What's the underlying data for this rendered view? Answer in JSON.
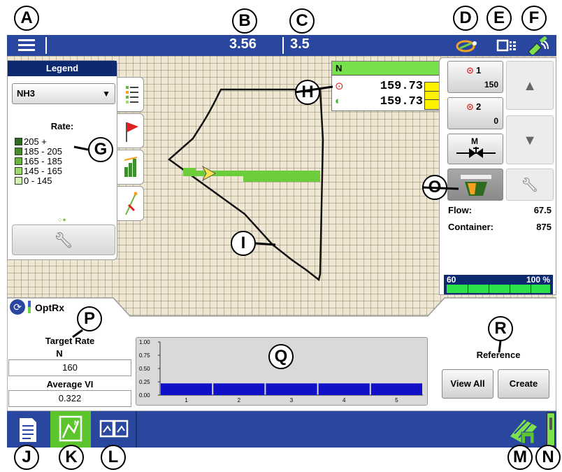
{
  "top_bar": {
    "value_b": "3.56",
    "value_c": "3.5",
    "menu_icon": "hamburger-menu-icon",
    "status_icons": [
      "guidance-icon",
      "implement-icon",
      "gps-satellite-icon"
    ]
  },
  "legend": {
    "title": "Legend",
    "product": "NH3",
    "rate_title": "Rate:",
    "ranges": [
      {
        "label": "205 +",
        "color": "#2e6b1f"
      },
      {
        "label": "185 - 205",
        "color": "#4a8a2a"
      },
      {
        "label": "165 - 185",
        "color": "#6cb33d"
      },
      {
        "label": "145 - 165",
        "color": "#9fd86a"
      },
      {
        "label": "0 - 145",
        "color": "#d4f2b2"
      }
    ],
    "tabs": [
      "legend-list-icon",
      "flag-icon",
      "bar-chart-icon",
      "guidance-line-icon"
    ]
  },
  "n_box": {
    "header": "N",
    "target_value": "159.73",
    "actual_value": "159.73"
  },
  "right_panel": {
    "rate1": {
      "label": "1",
      "value": "150"
    },
    "rate2": {
      "label": "2",
      "value": "0"
    },
    "manual_label": "M",
    "flow_label": "Flow:",
    "flow_value": "67.5",
    "container_label": "Container:",
    "container_value": "875",
    "tank_level_label": "60",
    "tank_percent_label": "100 %"
  },
  "bottom_panel": {
    "optrx_label": "OptRx",
    "target_rate_label": "Target Rate",
    "target_rate_product": "N",
    "target_rate_value": "160",
    "average_vi_label": "Average VI",
    "average_vi_value": "0.322",
    "reference_label": "Reference",
    "view_all_label": "View All",
    "create_label": "Create"
  },
  "chart_data": {
    "type": "bar",
    "categories": [
      "1",
      "2",
      "3",
      "4",
      "5"
    ],
    "values": [
      0.22,
      0.22,
      0.22,
      0.22,
      0.22
    ],
    "ylim": [
      0,
      1.0
    ],
    "yticks": [
      "1.00",
      "0.75",
      "0.50",
      "0.25",
      "0.00"
    ],
    "color": "#1010c8"
  },
  "bottom_bar": {
    "nav_icons": [
      "summary-icon",
      "map-screen-icon",
      "split-screen-icon"
    ],
    "right_icons": [
      "field-operations-icon",
      "master-switch-icon"
    ]
  },
  "callouts": [
    "A",
    "B",
    "C",
    "D",
    "E",
    "F",
    "G",
    "H",
    "I",
    "J",
    "K",
    "L",
    "M",
    "N",
    "O",
    "P",
    "Q",
    "R"
  ]
}
